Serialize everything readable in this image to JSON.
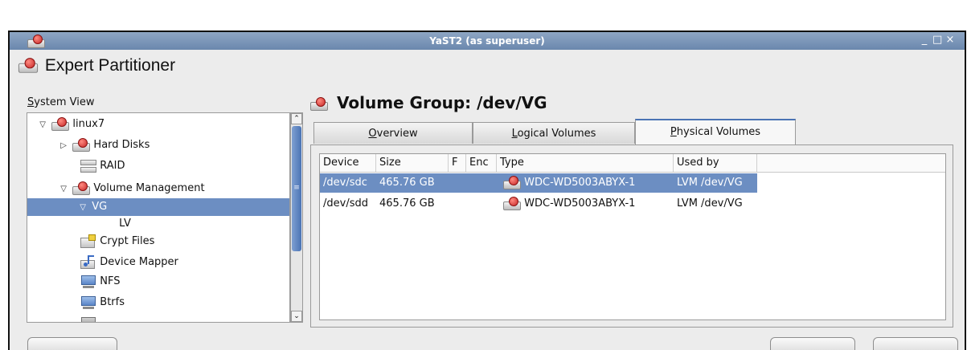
{
  "window": {
    "title": "YaST2 (as superuser)",
    "controls": [
      "_",
      "□",
      "×"
    ]
  },
  "header": {
    "title": "Expert Partitioner",
    "icon": "hard-disk-icon"
  },
  "system_view": {
    "label": "System View",
    "tree": [
      {
        "label": "linux7",
        "expander": "▽",
        "icon": "hard-disk-icon"
      },
      {
        "label": "Hard Disks",
        "expander": "▷",
        "icon": "hard-disk-icon"
      },
      {
        "label": "RAID",
        "expander": "",
        "icon": "raid-icon"
      },
      {
        "label": "Volume Management",
        "expander": "▽",
        "icon": "hard-disk-icon"
      },
      {
        "label": "VG",
        "expander": "▽",
        "icon": "",
        "selected": true
      },
      {
        "label": "LV",
        "expander": "",
        "icon": ""
      },
      {
        "label": "Crypt Files",
        "expander": "",
        "icon": "crypt-file-icon"
      },
      {
        "label": "Device Mapper",
        "expander": "",
        "icon": "device-mapper-icon"
      },
      {
        "label": "NFS",
        "expander": "",
        "icon": "nfs-icon"
      },
      {
        "label": "Btrfs",
        "expander": "",
        "icon": "btrfs-icon"
      }
    ]
  },
  "main": {
    "title": "Volume Group: /dev/VG",
    "tabs": [
      {
        "label": "Overview",
        "active": false
      },
      {
        "label": "Logical Volumes",
        "active": false
      },
      {
        "label": "Physical Volumes",
        "active": true
      }
    ],
    "table": {
      "columns": [
        "Device",
        "Size",
        "F",
        "Enc",
        "Type",
        "Used by"
      ],
      "rows": [
        {
          "device": "/dev/sdc",
          "size": "465.76 GB",
          "f": "",
          "enc": "",
          "type": "WDC-WD5003ABYX-1",
          "used_by": "LVM /dev/VG",
          "selected": true
        },
        {
          "device": "/dev/sdd",
          "size": "465.76 GB",
          "f": "",
          "enc": "",
          "type": "WDC-WD5003ABYX-1",
          "used_by": "LVM /dev/VG",
          "selected": false
        }
      ]
    }
  },
  "colors": {
    "selection": "#6c8ec2",
    "titlebar": "#7b96ba",
    "accent": "#4a73b4"
  }
}
